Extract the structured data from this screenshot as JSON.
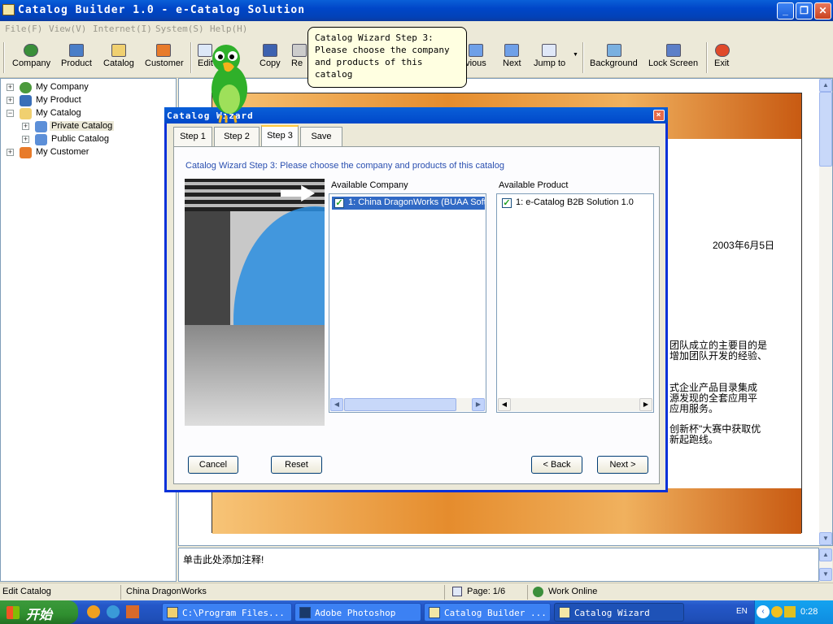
{
  "window": {
    "title": "Catalog Builder 1.0 - e-Catalog Solution"
  },
  "menu": [
    "File(F)",
    "View(V)",
    "Internet(I)",
    "System(S)",
    "Help(H)"
  ],
  "toolbar": {
    "company": "Company",
    "product": "Product",
    "catalog": "Catalog",
    "customer": "Customer",
    "edit": "Edit",
    "delete": "te",
    "copy": "Copy",
    "re": "Re",
    "previous": "evious",
    "next": "Next",
    "jumpto": "Jump to",
    "background": "Background",
    "lockscreen": "Lock Screen",
    "exit": "Exit"
  },
  "tree": {
    "my_company": "My Company",
    "my_product": "My Product",
    "my_catalog": "My Catalog",
    "private_catalog": "Private Catalog",
    "public_catalog": "Public Catalog",
    "my_customer": "My Customer"
  },
  "document": {
    "date": "2003年6月5日",
    "p1_line1": "团队成立的主要目的是",
    "p1_line2": "增加团队开发的经验、",
    "p2_line1": "式企业产品目录集成",
    "p2_line2": "源发现的全套应用平",
    "p2_line3": "应用服务。",
    "p3_line1": "创新杯\"大赛中获取优",
    "p3_line2": "新起跑线。"
  },
  "notes": {
    "placeholder": "单击此处添加注释!"
  },
  "status": {
    "mode": "Edit Catalog",
    "company": "China DragonWorks",
    "page": "Page: 1/6",
    "online": "Work Online"
  },
  "tooltip": {
    "text": "Catalog Wizard Step 3: Please choose the company and products of this catalog"
  },
  "dialog": {
    "title": "Catalog Wizard",
    "tabs": [
      "Step 1",
      "Step 2",
      "Step 3",
      "Save"
    ],
    "step_description": "Catalog Wizard Step 3: Please choose the company and products of this catalog",
    "available_company_label": "Available Company",
    "available_product_label": "Available Product",
    "companies": [
      "1: China DragonWorks (BUAA Soft"
    ],
    "products": [
      "1: e-Catalog B2B Solution 1.0"
    ],
    "buttons": {
      "cancel": "Cancel",
      "reset": "Reset",
      "back": "< Back",
      "next": "Next >"
    }
  },
  "taskbar": {
    "start": "开始",
    "tasks": [
      "C:\\Program Files...",
      "Adobe Photoshop",
      "Catalog Builder ...",
      "Catalog Wizard"
    ],
    "lang": "EN",
    "clock": "0:28"
  },
  "colors": {
    "accent": "#0a5fd8",
    "selection": "#316ac5",
    "doc_band": "#e58c2d"
  }
}
